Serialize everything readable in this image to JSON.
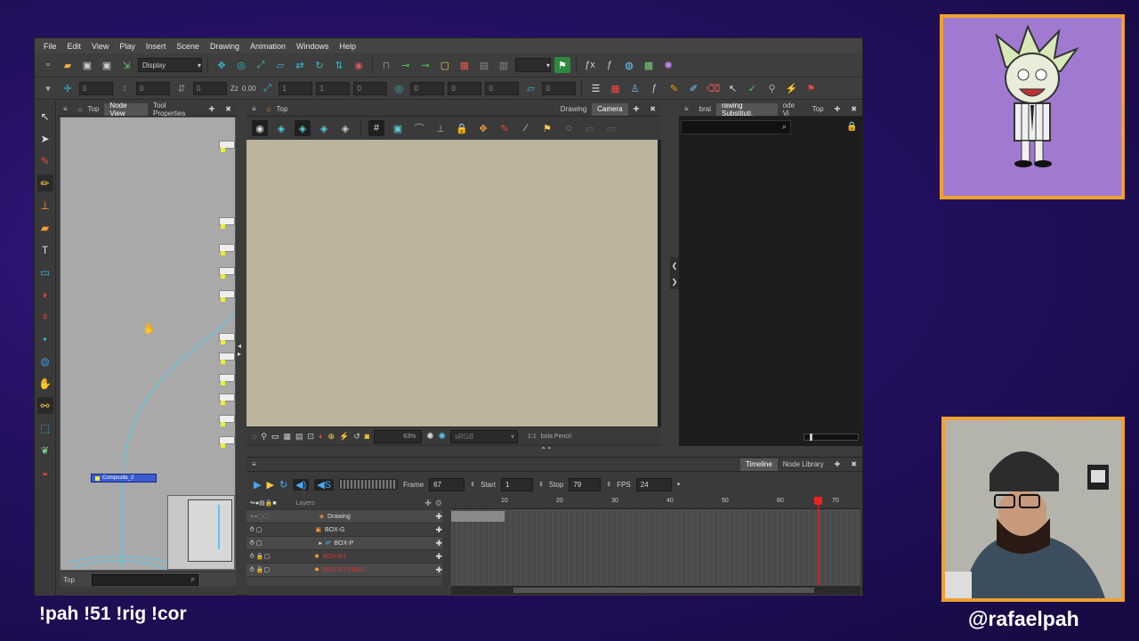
{
  "menubar": {
    "items": [
      "File",
      "Edit",
      "View",
      "Play",
      "Insert",
      "Scene",
      "Drawing",
      "Animation",
      "Windows",
      "Help"
    ]
  },
  "toolbar": {
    "display_select": "Display",
    "zoom_value": "0.00",
    "field_values": [
      "0",
      "0",
      "0",
      "1",
      "1",
      "0",
      "0",
      "0",
      "0",
      "0",
      "0"
    ]
  },
  "node_view": {
    "tabs": [
      "Top",
      "Node View",
      "Tool Properties"
    ],
    "composite_node": "Composite_2",
    "search_label": "Top"
  },
  "camera_view": {
    "breadcrumb": "Top",
    "tabs": [
      "Drawing",
      "Camera"
    ],
    "zoom": "63%",
    "color_space": "sRGB",
    "ratio": "1:1",
    "tool_status": "bola Pencil"
  },
  "library_panel": {
    "tabs": [
      "brai",
      "rawing Substituti.",
      "ode Vi",
      "Top"
    ]
  },
  "timeline": {
    "tabs": [
      "Timeline",
      "Node Library"
    ],
    "frame_label": "Frame",
    "frame_value": "67",
    "start_label": "Start",
    "start_value": "1",
    "stop_label": "Stop",
    "stop_value": "79",
    "fps_label": "FPS",
    "fps_value": "24",
    "layers_header": "Layers",
    "layers": [
      "Drawing",
      "BOX-G",
      "BOX-P",
      "BOX-R1",
      "BOX-R2-FINAL"
    ],
    "frame_numbers": [
      "10",
      "20",
      "30",
      "40",
      "50",
      "60",
      "70"
    ]
  },
  "overlay": {
    "chat_commands": "!pah !51 !rig !cor",
    "handle": "@rafaelpah"
  }
}
